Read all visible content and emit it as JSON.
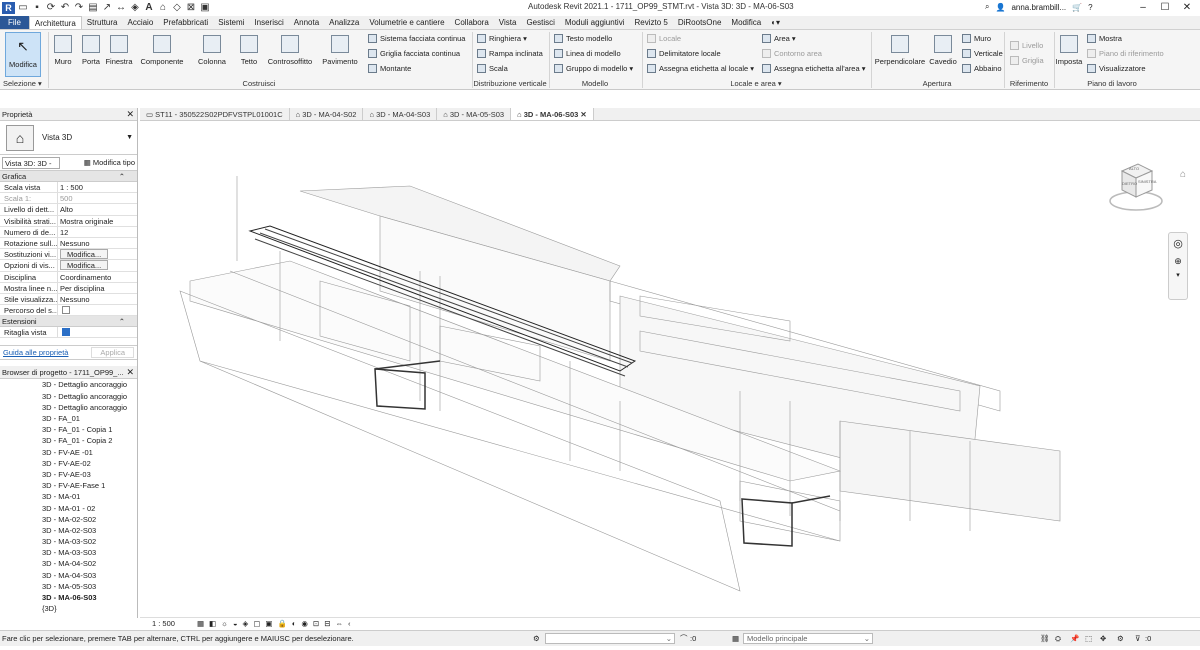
{
  "title_bar": {
    "title": "Autodesk Revit 2021.1 - 1711_OP99_STMT.rvt - Vista 3D: 3D - MA-06-S03",
    "user": "anna.brambill...",
    "qat_icons": [
      "open-icon",
      "save-icon",
      "sync-icon",
      "undo-icon",
      "redo-icon",
      "print-icon",
      "measure-icon",
      "dimension-icon",
      "tag-icon",
      "text-icon",
      "view-3d-icon",
      "section-icon",
      "close-hidden-icon",
      "switch-windows-icon"
    ]
  },
  "tabs": [
    "File",
    "Architettura",
    "Struttura",
    "Acciaio",
    "Prefabbricati",
    "Sistemi",
    "Inserisci",
    "Annota",
    "Analizza",
    "Volumetrie e cantiere",
    "Collabora",
    "Vista",
    "Gestisci",
    "Moduli aggiuntivi",
    "Revizto 5",
    "DiRootsOne",
    "Modifica"
  ],
  "active_tab": "Architettura",
  "ribbon": {
    "modifica": "Modifica",
    "selezione": "Selezione ▾",
    "costruisci": [
      "Muro",
      "Porta",
      "Finestra",
      "Componente",
      "Colonna",
      "Tetto",
      "Controsoffitto",
      "Pavimento"
    ],
    "costruisci_label": "Costruisci",
    "facciata": [
      "Sistema facciata continua",
      "Griglia facciata continua",
      "Montante"
    ],
    "circolazione": [
      "Ringhiera ▾",
      "Rampa inclinata",
      "Scala"
    ],
    "circolazione_label": "Distribuzione verticale",
    "modello": [
      "Testo modello",
      "Linea di modello",
      "Gruppo di modello ▾"
    ],
    "modello_label": "Modello",
    "locale": [
      "Locale",
      "Delimitatore  locale",
      "Assegna etichetta  al locale ▾"
    ],
    "area": [
      "Area ▾",
      "Contorno  area",
      "Assegna etichetta  all'area ▾"
    ],
    "locale_label": "Locale e area ▾",
    "apertura": [
      "Perpendicolare",
      "Cavedio"
    ],
    "apertura_small": [
      "Muro",
      "Verticale",
      "Abbaino"
    ],
    "apertura_label": "Apertura",
    "riferimento": [
      "Livello",
      "Griglia"
    ],
    "riferimento_label": "Riferimento",
    "piano": [
      "Imposta"
    ],
    "piano_small": [
      "Mostra",
      "Piano di riferimento",
      "Visualizzatore"
    ],
    "piano_label": "Piano di lavoro"
  },
  "properties": {
    "header": "Proprietà",
    "type": "Vista 3D",
    "view_selector": "Vista 3D: 3D - M",
    "edit_type": "Modifica tipo",
    "cat_grafica": "Grafica",
    "rows": [
      {
        "k": "Scala vista",
        "v": "1 : 500"
      },
      {
        "k": "Scala  1:",
        "v": "500",
        "dim": true
      },
      {
        "k": "Livello di dett...",
        "v": "Alto"
      },
      {
        "k": "Visibilità strati...",
        "v": "Mostra originale"
      },
      {
        "k": "Numero di de...",
        "v": "12"
      },
      {
        "k": "Rotazione sull...",
        "v": "Nessuno"
      },
      {
        "k": "Sostituzioni vi...",
        "v": "Modifica...",
        "btn": true
      },
      {
        "k": "Opzioni di vis...",
        "v": "Modifica...",
        "btn": true
      },
      {
        "k": "Disciplina",
        "v": "Coordinamento"
      },
      {
        "k": "Mostra linee n...",
        "v": "Per disciplina"
      },
      {
        "k": "Stile visualizza...",
        "v": "Nessuno"
      },
      {
        "k": "Percorso del s...",
        "v": "",
        "check": false
      }
    ],
    "cat_estensioni": "Estensioni",
    "crop": "Ritaglia vista",
    "crop_checked": true,
    "help_link": "Guida alle proprietà",
    "apply": "Applica"
  },
  "browser": {
    "header": "Browser di progetto - 1711_OP99_...",
    "items": [
      "3D - Dettaglio ancoraggio",
      "3D - Dettaglio ancoraggio",
      "3D - Dettaglio ancoraggio",
      "3D - FA_01",
      "3D - FA_01 - Copia 1",
      "3D - FA_01 - Copia 2",
      "3D - FV-AE -01",
      "3D - FV-AE-02",
      "3D - FV-AE-03",
      "3D - FV-AE-Fase 1",
      "3D - MA-01",
      "3D - MA-01 - 02",
      "3D - MA-02-S02",
      "3D - MA-02-S03",
      "3D - MA-03-S02",
      "3D - MA-03-S03",
      "3D - MA-04-S02",
      "3D - MA-04-S03",
      "3D - MA-05-S03",
      "3D - MA-06-S03",
      "{3D}"
    ],
    "selected": "3D - MA-06-S03"
  },
  "view_tabs": [
    "ST11 - 350522S02PDFVSTPL01001C",
    "3D - MA-04-S02",
    "3D - MA-04-S03",
    "3D - MA-05-S03",
    "3D - MA-06-S03"
  ],
  "active_view_tab": "3D - MA-06-S03",
  "viewcube": {
    "top": "ALTO",
    "front": "DIETRO",
    "right": "SINISTRA"
  },
  "view_bar": {
    "scale": "1 : 500"
  },
  "status": {
    "message": "Fare clic per selezionare, premere TAB per alternare, CTRL per aggiungere e MAIUSC per deselezionare.",
    "coord": ":0",
    "model": "Modello principale",
    "filter": ":0"
  }
}
